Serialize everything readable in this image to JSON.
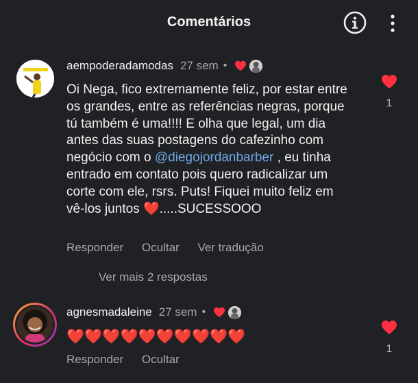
{
  "header": {
    "title": "Comentários",
    "info_icon": "info-circle-icon",
    "more_icon": "more-vertical-icon"
  },
  "comments": [
    {
      "username": "aempoderadamodas",
      "time": "27 sem",
      "separator": "•",
      "author_liked": true,
      "text_before": "Oi Nega, fico extremamente feliz, por estar entre os grandes, entre as referências negras, porque tú também é uma!!!! E olha que legal, um dia antes das suas postagens do cafezinho com negócio com o ",
      "mention": "@diegojordanbarber",
      "text_after": " , eu tinha entrado em contato pois quero radicalizar um corte com ele, rsrs. Puts! Fiquei muito feliz em vê-los juntos ❤️.....SUCESSOOO",
      "actions": [
        "Responder",
        "Ocultar",
        "Ver tradução"
      ],
      "more_replies": "Ver mais 2 respostas",
      "likes": "1",
      "like_color": "#ff3040"
    },
    {
      "username": "agnesmadaleine",
      "time": "27 sem",
      "separator": "•",
      "author_liked": true,
      "text": "❤️❤️❤️❤️❤️❤️❤️❤️❤️❤️",
      "actions": [
        "Responder",
        "Ocultar"
      ],
      "likes": "1",
      "like_color": "#ff3040"
    }
  ],
  "colors": {
    "background": "#202124",
    "text": "#f2f2f2",
    "muted": "#a8a8a8",
    "mention": "#6fa7e9",
    "heart": "#ff3040"
  }
}
